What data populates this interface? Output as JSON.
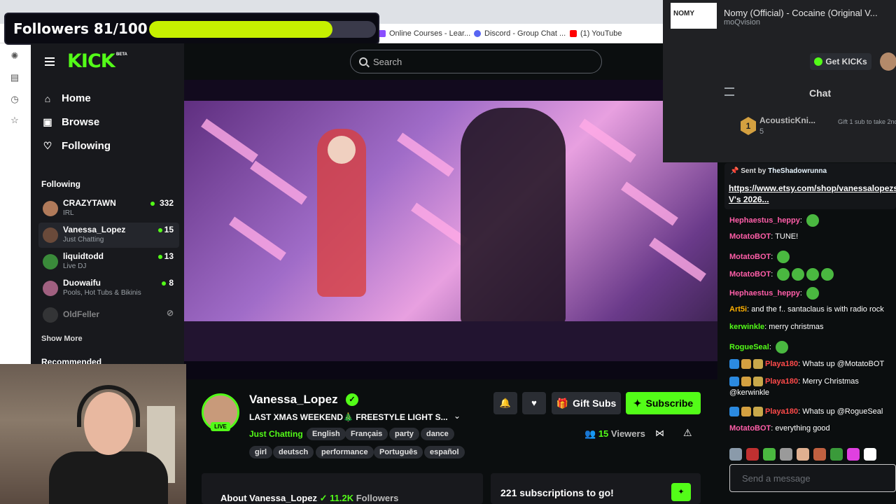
{
  "overlay": {
    "followers_label": "Followers 81/100",
    "progress": 0.81
  },
  "bookmarks": [
    {
      "label": "Online Courses - Lear...",
      "color": "#8a4fff"
    },
    {
      "label": "Discord - Group Chat ...",
      "color": "#5865f2"
    },
    {
      "label": "(1) YouTube",
      "color": "#ff0000"
    }
  ],
  "media": {
    "thumb_text": "NOMY",
    "title": "Nomy (Official) - Cocaine (Original V...",
    "channel": "moQvision"
  },
  "kick": {
    "logo": "KICK",
    "beta": "BETA",
    "search_placeholder": "Search",
    "get_kicks": "Get KICKs",
    "nav": {
      "home": "Home",
      "browse": "Browse",
      "following": "Following"
    },
    "following_title": "Following",
    "following": [
      {
        "name": "CRAZYTAWN",
        "category": "IRL",
        "viewers": "332",
        "live": true,
        "color": "#b07a5a"
      },
      {
        "name": "Vanessa_Lopez",
        "category": "Just Chatting",
        "viewers": "15",
        "live": true,
        "color": "#6a4a3a"
      },
      {
        "name": "liquidtodd",
        "category": "Live DJ",
        "viewers": "13",
        "live": true,
        "color": "#3a8a3a"
      },
      {
        "name": "Duowaifu",
        "category": "Pools, Hot Tubs & Bikinis",
        "viewers": "8",
        "live": true,
        "color": "#a06080"
      },
      {
        "name": "OldFeller",
        "category": "",
        "viewers": "",
        "live": false,
        "color": "#555"
      }
    ],
    "show_more": "Show More",
    "recommended": "Recommended"
  },
  "stream": {
    "streamer": "Vanessa_Lopez",
    "live": "LIVE",
    "title": "LAST XMAS WEEKEND🎄 FREESTYLE LIGHT S...",
    "category": "Just Chatting",
    "tags": [
      "English",
      "Français",
      "party",
      "dance",
      "girl",
      "deutsch",
      "performance",
      "Português",
      "español"
    ],
    "gift_subs": "Gift Subs",
    "subscribe": "Subscribe",
    "viewers_count": "15",
    "viewers_label": "Viewers",
    "about_label": "About Vanessa_Lopez",
    "followers_count": "11.2K",
    "followers_word": "Followers",
    "subs_to_go": "221 subscriptions to go!"
  },
  "chat": {
    "title": "Chat",
    "gift": {
      "name": "AcousticKni...",
      "count": "5",
      "rank": "1",
      "note": "Gift 1 sub to take 2nd"
    },
    "pinned": {
      "sent_by": "Sent by",
      "user": "TheShadowrunna",
      "link": "https://www.etsy.com/shop/vanessalopezshop/",
      "after": " V's 2026..."
    },
    "messages": [
      {
        "user": "Hephaestus_heppy",
        "color": "#ff5ea8",
        "text": "",
        "emotes": 1
      },
      {
        "user": "MotatoBOT",
        "color": "#ff5ea8",
        "text": "TUNE!",
        "emotes": 0
      },
      {
        "user": "MotatoBOT",
        "color": "#ff5ea8",
        "text": "",
        "emotes": 1
      },
      {
        "user": "MotatoBOT",
        "color": "#ff5ea8",
        "text": "",
        "emotes": 4
      },
      {
        "user": "Hephaestus_heppy",
        "color": "#ff5ea8",
        "text": "",
        "emotes": 1
      },
      {
        "user": "Art5i",
        "color": "#ffb000",
        "text": "and the f.. santaclaus is with radio rock",
        "emotes": 0
      },
      {
        "user": "kerwinkle",
        "color": "#53fc18",
        "text": "merry christmas",
        "emotes": 0
      },
      {
        "user": "RogueSeal",
        "color": "#53fc18",
        "text": "",
        "emotes": 1
      },
      {
        "user": "Playa180",
        "color": "#ff4a4a",
        "text": "Whats up @MotatoBOT",
        "emotes": 0
      },
      {
        "user": "Playa180",
        "color": "#ff4a4a",
        "text": "Merry Christmas",
        "emotes": 0
      },
      {
        "user": "",
        "color": "#fff",
        "text": "@kerwinkle",
        "emotes": 0
      },
      {
        "user": "Playa180",
        "color": "#ff4a4a",
        "text": "Whats up @RogueSeal",
        "emotes": 0
      },
      {
        "user": "MotatoBOT",
        "color": "#ff5ea8",
        "text": "everything good",
        "emotes": 0
      }
    ],
    "input_placeholder": "Send a message"
  }
}
